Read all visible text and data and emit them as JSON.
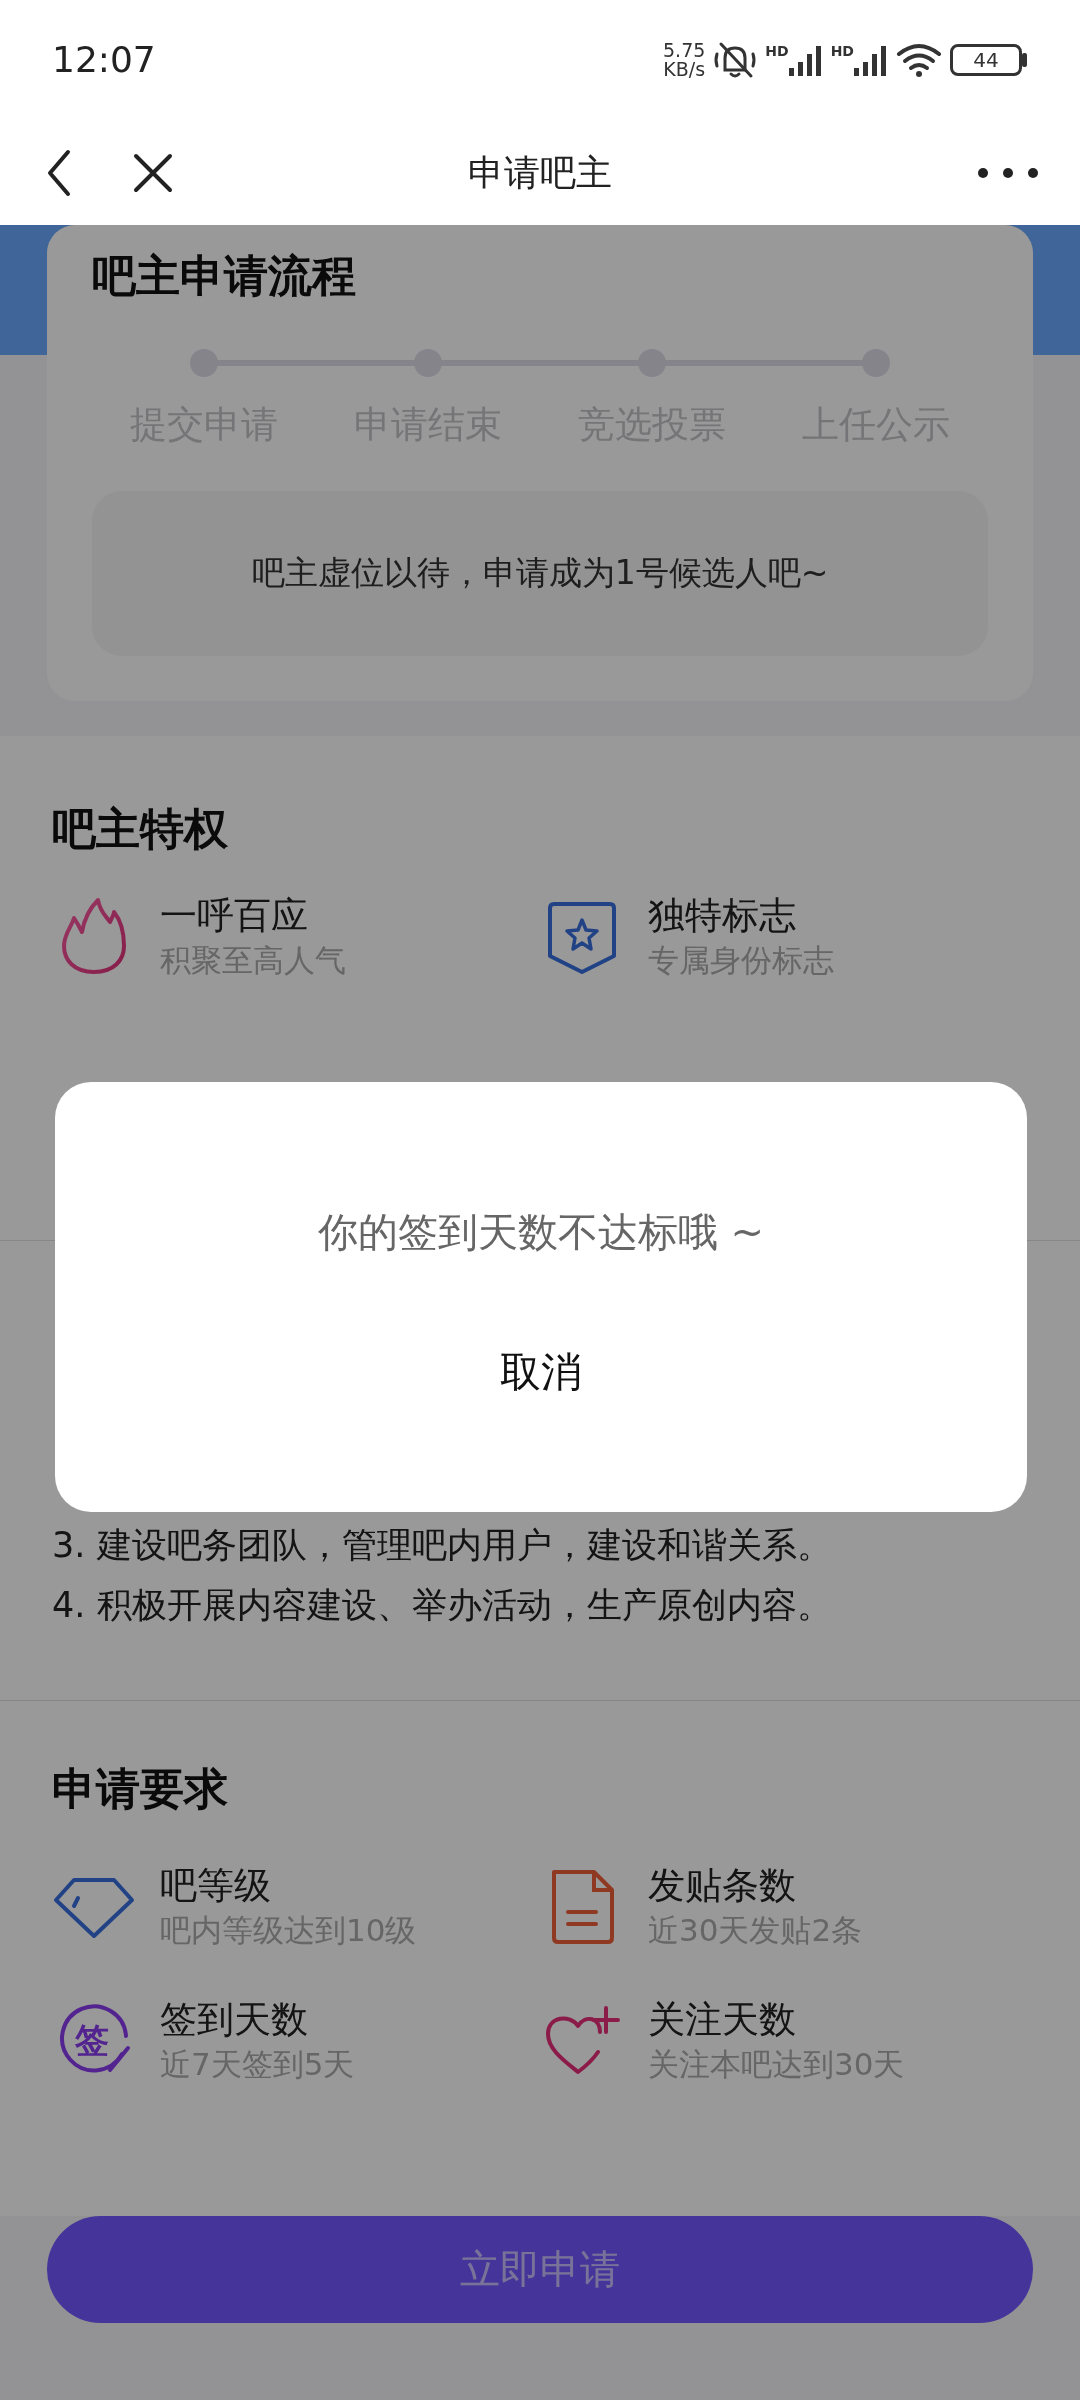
{
  "status_bar": {
    "time": "12:07",
    "net_speed": "5.75",
    "net_unit": "KB/s",
    "signals": [
      {
        "label": "HD"
      },
      {
        "label": "HD"
      }
    ],
    "battery": "44"
  },
  "nav": {
    "title": "申请吧主"
  },
  "process": {
    "title": "吧主申请流程",
    "steps": [
      "提交申请",
      "申请结束",
      "竞选投票",
      "上任公示"
    ],
    "note": "吧主虚位以待，申请成为1号候选人吧~"
  },
  "privileges": {
    "title": "吧主特权",
    "items": [
      {
        "title": "一呼百应",
        "desc": "积聚至高人气"
      },
      {
        "title": "独特标志",
        "desc": "专属身份标志"
      }
    ]
  },
  "duties": {
    "lines": [
      "3. 建设吧务团队，管理吧内用户，建设和谐关系。",
      "4. 积极开展内容建设、举办活动，生产原创内容。"
    ]
  },
  "requirements": {
    "title": "申请要求",
    "items": [
      {
        "title": "吧等级",
        "desc": "吧内等级达到10级"
      },
      {
        "title": "发贴条数",
        "desc": "近30天发贴2条"
      },
      {
        "title": "签到天数",
        "desc": "近7天签到5天",
        "icon_text": "签"
      },
      {
        "title": "关注天数",
        "desc": "关注本吧达到30天"
      }
    ]
  },
  "apply_button": "立即申请",
  "dialog": {
    "message": "你的签到天数不达标哦 ~",
    "cancel": "取消"
  }
}
